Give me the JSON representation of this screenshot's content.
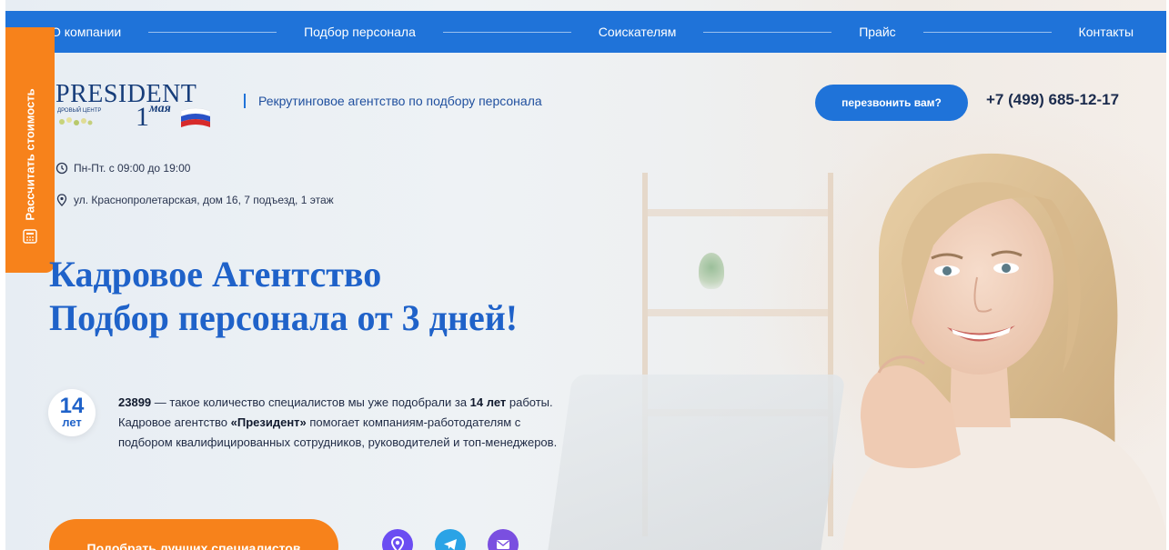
{
  "nav": {
    "items": [
      "О компании",
      "Подбор персонала",
      "Соискателям",
      "Прайс",
      "Контакты"
    ]
  },
  "side_tab": {
    "label": "Рассчитать стоимость"
  },
  "header": {
    "logo_word": "PRESIDENT",
    "logo_sub": "ДРОВЫЙ ЦЕНТР",
    "logo_may": "мая",
    "logo_num": "1",
    "tagline": "Рекрутинговое агентство по подбору персонала",
    "callback": "перезвонить вам?",
    "phone": "+7 (499) 685-12-17"
  },
  "info": {
    "hours": "Пн-Пт. с 09:00 до 19:00",
    "address": "ул. Краснопролетарская, дом 16, 7 подъезд, 1 этаж"
  },
  "hero": {
    "title_line1": "Кадровое Агентство",
    "title_line2": "Подбор персонала от 3 дней!",
    "badge_number": "14",
    "badge_unit": "лет",
    "count": "23899",
    "text1": " — такое количество специалистов мы уже подобрали за ",
    "years": "14 лет",
    "text2": " работы.",
    "text3": "Кадровое агентство ",
    "brand": "«Президент»",
    "text4": " помогает компаниям-работодателям с",
    "text5": "подбором квалифицированных сотрудников, руководителей и топ-менеджеров.",
    "cta": "Подобрать лучших специалистов"
  },
  "colors": {
    "primary": "#1f73d9",
    "accent": "#f7821b",
    "title": "#1f62c9"
  },
  "icons": [
    "clock-icon",
    "location-icon",
    "calculator-icon",
    "map-pin-icon",
    "telegram-icon",
    "mail-icon"
  ]
}
